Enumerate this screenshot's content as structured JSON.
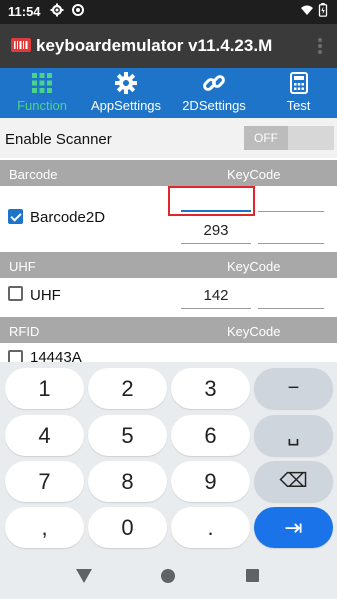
{
  "status_bar": {
    "time": "11:54",
    "icons": [
      "gear-icon",
      "settings-icon",
      "wifi-icon",
      "battery-icon"
    ]
  },
  "app": {
    "title": "keyboardemulator v11.4.23.M",
    "icons": [
      "app-logo-icon",
      "overflow-menu-icon"
    ]
  },
  "tabs": [
    {
      "label": "Function",
      "icon": "grid-icon",
      "active": true
    },
    {
      "label": "AppSettings",
      "icon": "gear-icon",
      "active": false
    },
    {
      "label": "2DSettings",
      "icon": "link-icon",
      "active": false
    },
    {
      "label": "Test",
      "icon": "calculator-icon",
      "active": false
    }
  ],
  "enable_scanner": {
    "label": "Enable Scanner",
    "toggle_label": "OFF",
    "on": false
  },
  "sections": {
    "barcode": {
      "title": "Barcode",
      "keycode_header": "KeyCode"
    },
    "uhf": {
      "title": "UHF",
      "keycode_header": "KeyCode"
    },
    "rfid": {
      "title": "RFID",
      "keycode_header": "KeyCode"
    }
  },
  "rows": {
    "barcode2d": {
      "label": "Barcode2D",
      "checked": true,
      "field_top": "",
      "keycode": "293",
      "field_extra": ""
    },
    "uhf": {
      "label": "UHF",
      "checked": false,
      "keycode": "142",
      "field_extra": ""
    },
    "rfid_14443a": {
      "label": "14443A",
      "checked": false
    }
  },
  "keyboard": {
    "keys": [
      [
        "1",
        "2",
        "3",
        "−"
      ],
      [
        "4",
        "5",
        "6",
        "␣"
      ],
      [
        "7",
        "8",
        "9",
        "⌫"
      ],
      [
        ",",
        "0",
        ".",
        "⇥"
      ]
    ]
  },
  "nav_bar": {
    "icons": [
      "back-icon",
      "home-icon",
      "recents-icon"
    ]
  },
  "colors": {
    "tab_bar": "#1e74c8",
    "active_tab_label": "#4cd28b",
    "app_bar": "#3a3a3a",
    "section_header": "#a8a8a8",
    "highlight_box": "#e0262b",
    "action_key": "#1a73e8"
  }
}
